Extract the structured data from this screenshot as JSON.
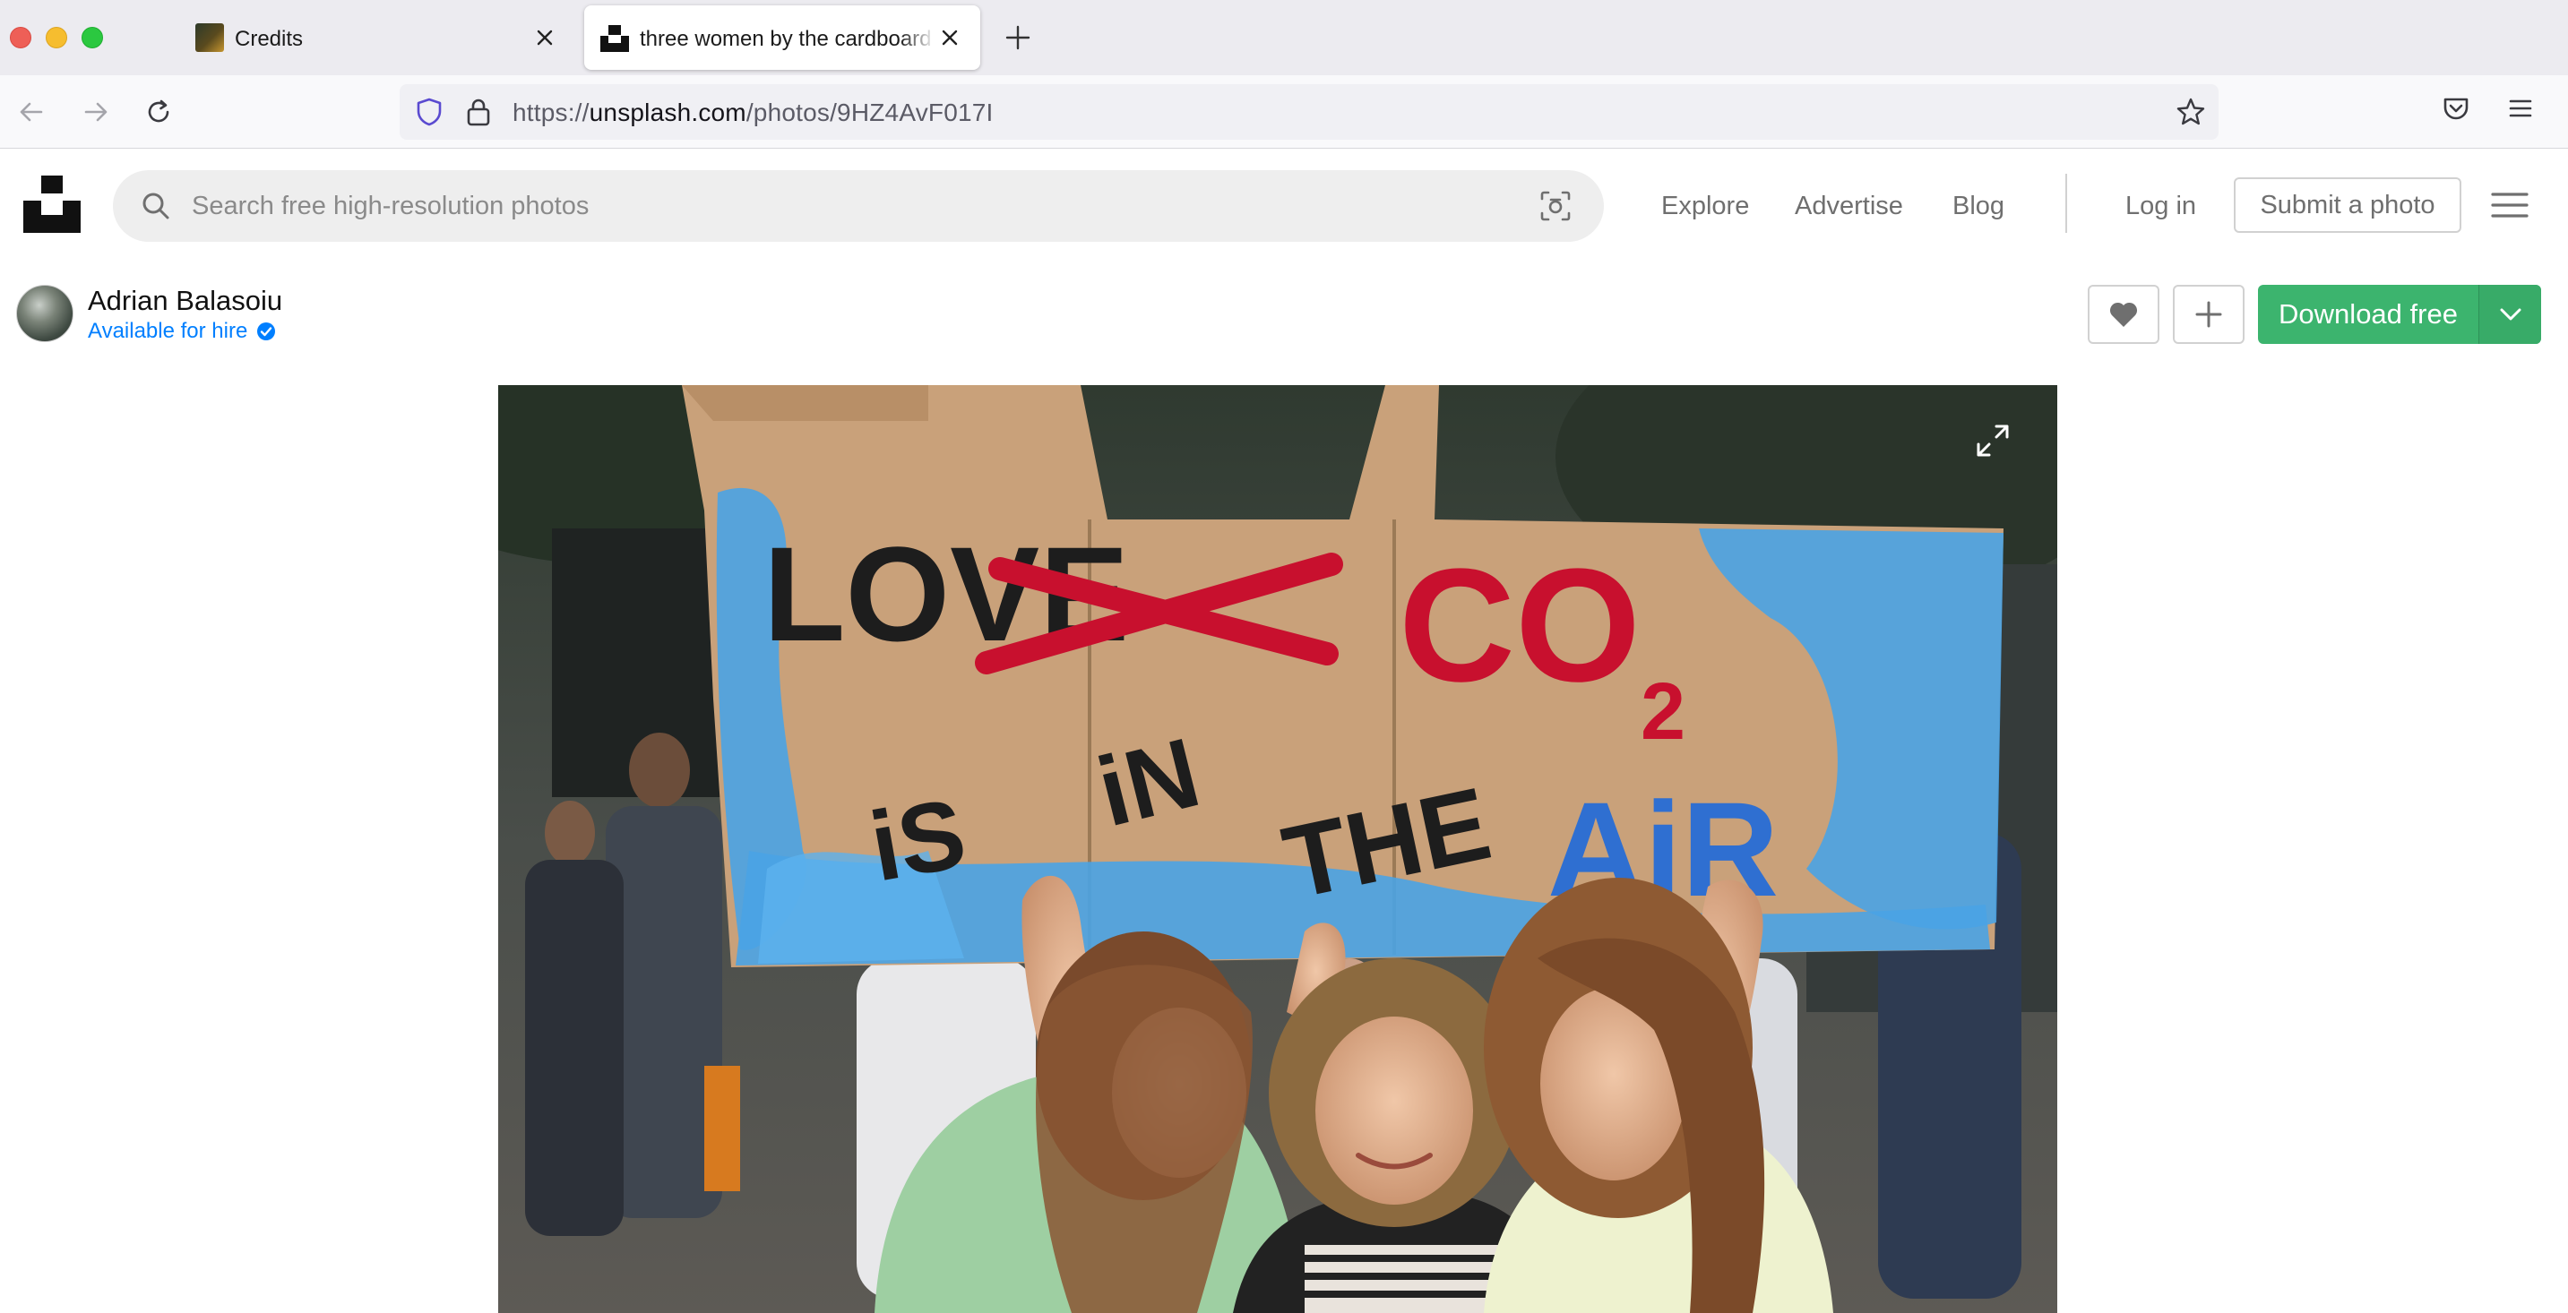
{
  "browser": {
    "tabs": [
      {
        "title": "Credits",
        "active": false
      },
      {
        "title": "three women by the cardboard paper photo – Free Image on Unsplash",
        "active": true
      }
    ],
    "url": {
      "scheme": "https://",
      "host": "unsplash.com",
      "path": "/photos/9HZ4AvF017I"
    }
  },
  "site": {
    "search_placeholder": "Search free high-resolution photos",
    "nav": {
      "explore": "Explore",
      "advertise": "Advertise",
      "blog": "Blog",
      "login": "Log in",
      "submit": "Submit a photo"
    }
  },
  "photo_page": {
    "author": "Adrian Balasoiu",
    "hire_label": "Available for hire",
    "download_label": "Download free"
  },
  "photo": {
    "sign": {
      "crossed_word": "LOVE",
      "chemical": "CO",
      "subscript": "2",
      "line_is": "iS",
      "line_in": "iN",
      "line_the": "THE",
      "line_air": "AiR"
    }
  },
  "colors": {
    "accent_green": "#3cb46e",
    "link_blue": "#007fff",
    "sign_red": "#c8102e",
    "sign_blue": "#3a86d6"
  }
}
